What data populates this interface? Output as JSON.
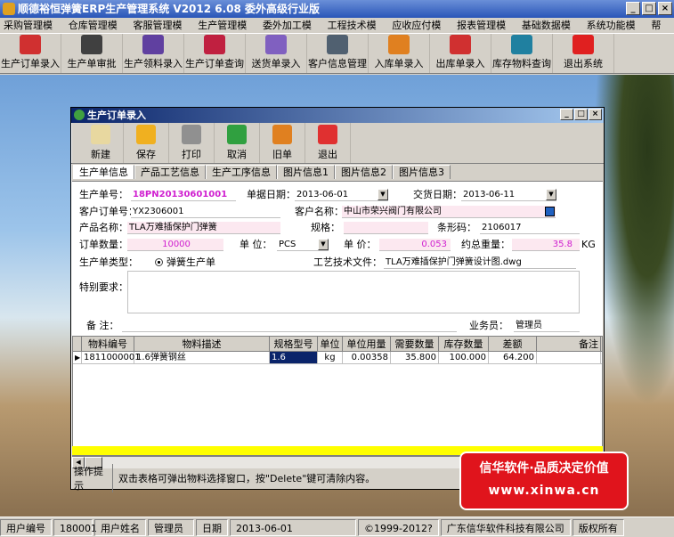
{
  "app": {
    "title": "顺德裕恒弹簧ERP生产管理系统  V2012 6.08 委外高级行业版"
  },
  "menu": [
    "采购管理模块",
    "仓库管理模块",
    "客服管理模块",
    "生产管理模块",
    "委外加工模块",
    "工程技术模块",
    "应收应付模块",
    "报表管理模块",
    "基础数据模块",
    "系统功能模块",
    "帮助"
  ],
  "toolbar": [
    {
      "label": "生产订单录入",
      "icon": "pdf-document-icon",
      "color": "#d03030"
    },
    {
      "label": "生产单审批",
      "icon": "person-approve-icon",
      "color": "#404040"
    },
    {
      "label": "生产领料录入",
      "icon": "feather-pen-icon",
      "color": "#6040a0"
    },
    {
      "label": "生产订单查询",
      "icon": "query-icon",
      "color": "#c02040"
    },
    {
      "label": "送货单录入",
      "icon": "pen-paper-icon",
      "color": "#8060c0"
    },
    {
      "label": "客户信息管理",
      "icon": "people-icon",
      "color": "#506070"
    },
    {
      "label": "入库单录入",
      "icon": "flower-icon",
      "color": "#e08020"
    },
    {
      "label": "出库单录入",
      "icon": "flag-icon",
      "color": "#d03030"
    },
    {
      "label": "库存物料查询",
      "icon": "brush-icon",
      "color": "#2080a0"
    },
    {
      "label": "退出系统",
      "icon": "exit-power-icon",
      "color": "#e02020"
    }
  ],
  "window": {
    "title": "生产订单录入"
  },
  "wtools": [
    {
      "label": "新建",
      "icon": "new-doc-icon",
      "color": "#e8d8a0"
    },
    {
      "label": "保存",
      "icon": "save-icon",
      "color": "#f0b020"
    },
    {
      "label": "打印",
      "icon": "printer-icon",
      "color": "#909090"
    },
    {
      "label": "取消",
      "icon": "undo-icon",
      "color": "#30a040"
    },
    {
      "label": "旧单",
      "icon": "old-order-icon",
      "color": "#e08020"
    },
    {
      "label": "退出",
      "icon": "exit-icon",
      "color": "#e03030"
    }
  ],
  "tabs": [
    "生产单信息",
    "产品工艺信息",
    "生产工序信息",
    "图片信息1",
    "图片信息2",
    "图片信息3"
  ],
  "form": {
    "order_no_label": "生产单号：",
    "order_no": "18PN20130601001",
    "order_date_label": "单据日期：",
    "order_date": "2013-06-01",
    "delivery_label": "交货日期：",
    "delivery": "2013-06-11",
    "cust_order_label": "客户订单号：",
    "cust_order": "YX2306001",
    "cust_name_label": "客户名称：",
    "cust_name": "中山市荣兴阀门有限公司",
    "product_label": "产品名称：",
    "product": "TLA万难插保护门弹簧",
    "spec_label": "规格：",
    "spec": "",
    "barcode_label": "条形码：",
    "barcode": "2106017",
    "qty_label": "订单数量：",
    "qty": "10000",
    "unit_label": "单   位：",
    "unit": "PCS",
    "price_label": "单   价：",
    "price": "0.053",
    "weight_label": "约总重量：",
    "weight": "35.8",
    "weight_unit": "KG",
    "type_label": "生产单类型：",
    "type": "弹簧生产单",
    "tech_label": "工艺技术文件：",
    "tech": "TLA万难插保护门弹簧设计图.dwg",
    "special_label": "特别要求：",
    "remark_label": "备  注：",
    "sales_label": "业务员：",
    "sales": "管理员"
  },
  "grid": {
    "headers": [
      "物料编号",
      "物料描述",
      "规格型号",
      "单位",
      "单位用量",
      "需要数量",
      "库存数量",
      "差额",
      "备注"
    ],
    "rows": [
      [
        "1811000001",
        "1.6弹簧钢丝",
        "1.6",
        "kg",
        "0.00358",
        "35.800",
        "100.000",
        "64.200",
        ""
      ]
    ]
  },
  "hint": {
    "label": "操作提示",
    "text": "双击表格可弹出物料选择窗口，按\"Delete\"键可清除内容。"
  },
  "status": {
    "user_no_label": "用户编号",
    "user_no": "180001",
    "user_name_label": "用户姓名",
    "user_name": "管理员",
    "date_label": "日期",
    "date": "2013-06-01",
    "copyright": "©1999-2012?",
    "company": "广东信华软件科技有限公司",
    "rights": "版权所有"
  },
  "stamp": {
    "line1": "信华软件·品质决定价值",
    "line2": "www.xinwa.cn"
  }
}
